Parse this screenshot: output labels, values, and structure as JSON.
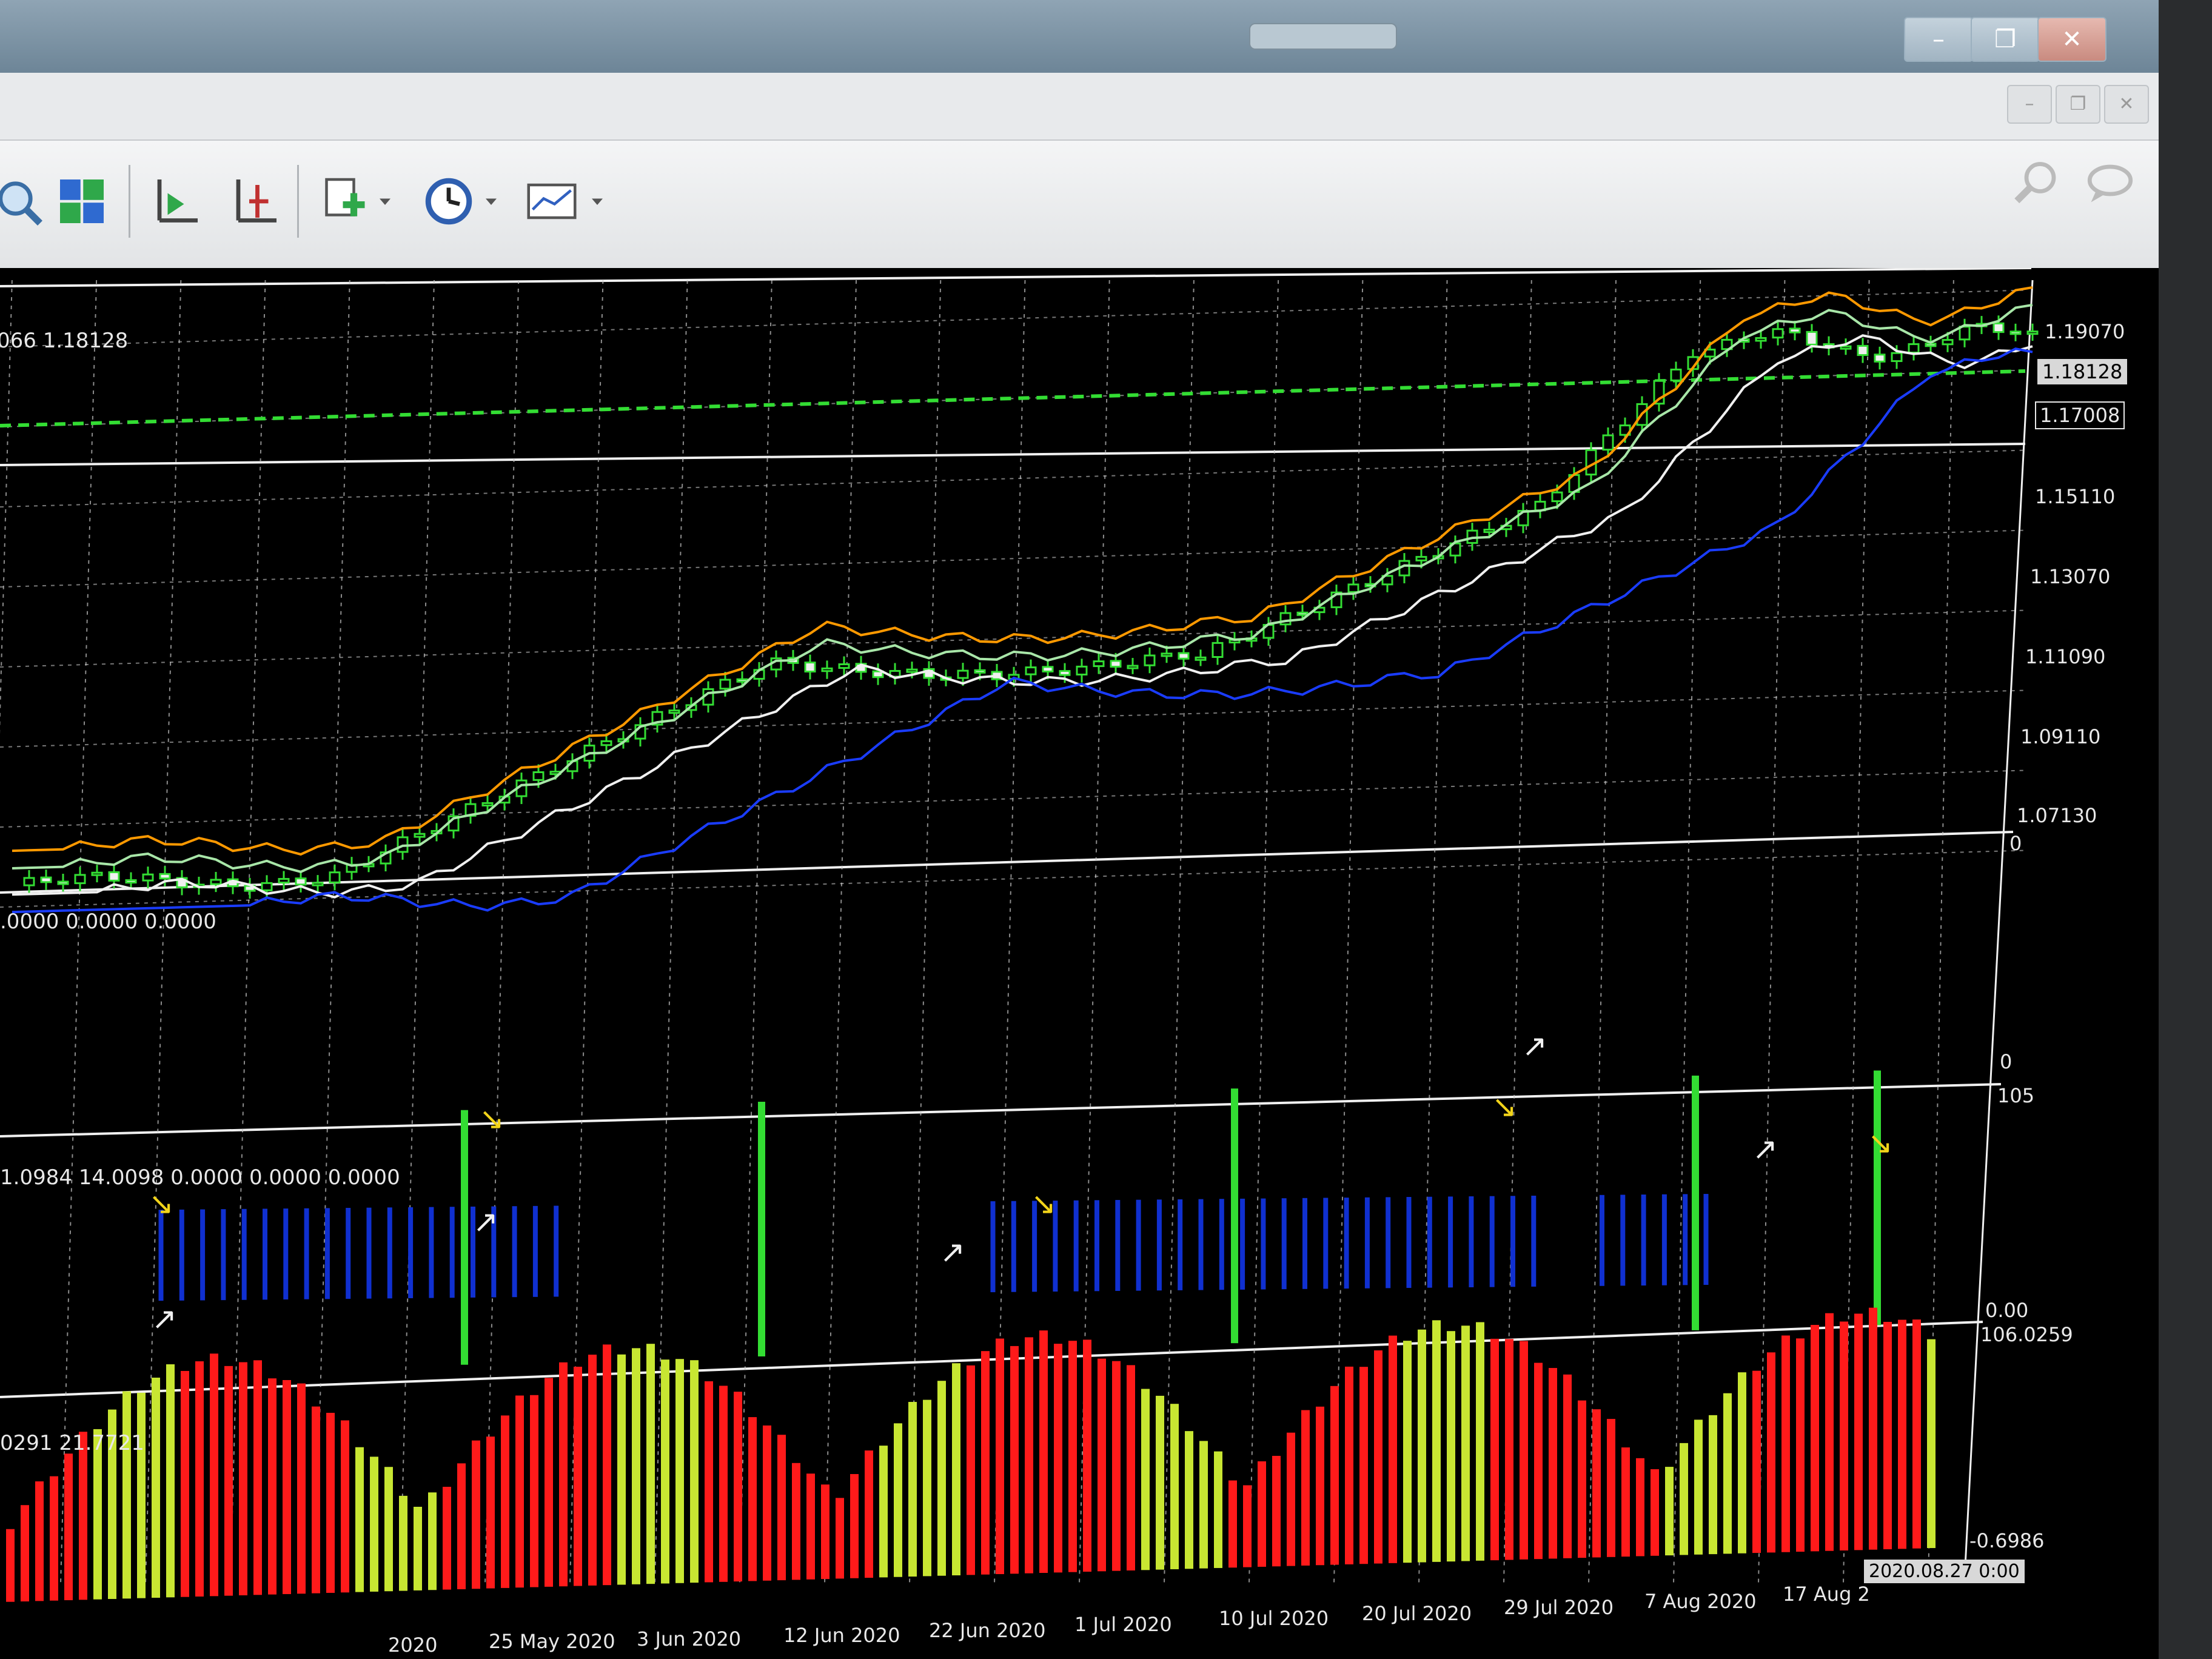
{
  "window": {
    "minimize": "–",
    "maximize": "❐",
    "close": "✕"
  },
  "toolbar": {
    "icons": [
      "zoom-out-icon",
      "tile-windows-icon",
      "autoscroll-icon",
      "chart-shift-icon",
      "add-indicator-icon",
      "periods-icon",
      "templates-icon",
      "search-icon",
      "chat-icon"
    ]
  },
  "colors": {
    "background": "#000000",
    "grid": "#c8c8c8",
    "bull": "#33dd33",
    "orange": "#ff9900",
    "lightgreen": "#a8e6a8",
    "white": "#f0f0f0",
    "blue": "#1a3cff",
    "red": "#ff1a1a",
    "yellowgreen": "#c8e632",
    "volblue": "#1030d0"
  },
  "panel1": {
    "header": "066 1.18128",
    "price_labels": [
      "1.19070",
      "1.18128",
      "1.17008",
      "1.15110",
      "1.13070",
      "1.11090",
      "1.09110",
      "1.07130"
    ]
  },
  "panel2": {
    "header": ".0000 0.0000 0.0000",
    "top_label": "0",
    "bottom_label": "0"
  },
  "panel3": {
    "header": "1.0984 14.0098 0.0000 0.0000 0.0000",
    "top_label": "105",
    "bottom_label": "0.00"
  },
  "panel4": {
    "header": "0291 21.7721",
    "top_label": "106.0259",
    "bottom_label": "-0.6986"
  },
  "time": {
    "dates": [
      "2020",
      "25 May 2020",
      "3 Jun 2020",
      "12 Jun 2020",
      "22 Jun 2020",
      "1 Jul 2020",
      "10 Jul 2020",
      "20 Jul 2020",
      "29 Jul 2020",
      "7 Aug 2020",
      "17 Aug 2"
    ],
    "cursor_label": "2020.08.27 0:00"
  },
  "chart_data": {
    "type": "candlestick",
    "symbol_last": "1.18128",
    "price_scale": [
      "1.19070",
      "1.18128",
      "1.17008",
      "1.15110",
      "1.13070",
      "1.11090",
      "1.09110",
      "1.07130"
    ],
    "x_dates": [
      "2020",
      "25 May 2020",
      "3 Jun 2020",
      "12 Jun 2020",
      "22 Jun 2020",
      "1 Jul 2020",
      "10 Jul 2020",
      "20 Jul 2020",
      "29 Jul 2020",
      "7 Aug 2020",
      "17 Aug 2"
    ],
    "indicator_scales": [
      [
        "0",
        "0"
      ],
      [
        "105",
        "0.00"
      ],
      [
        "106.0259",
        "-0.6986"
      ]
    ]
  }
}
